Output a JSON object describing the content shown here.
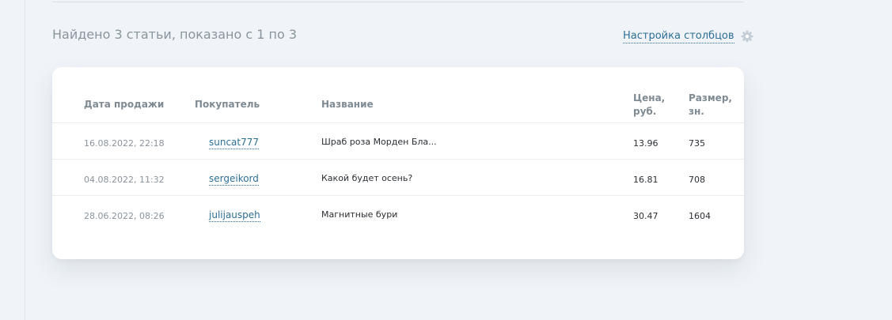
{
  "summary": "Найдено 3 статьи, показано с 1 по 3",
  "column_settings": {
    "label": "Настройка столбцов",
    "icon": "gear-icon"
  },
  "table": {
    "headers": {
      "date": "Дата продажи",
      "buyer": "Покупатель",
      "title": "Название",
      "price_line1": "Цена,",
      "price_line2": "руб.",
      "size_line1": "Размер,",
      "size_line2": "зн."
    },
    "rows": [
      {
        "date": "16.08.2022, 22:18",
        "buyer": "suncat777",
        "title": "Шраб роза Морден Бла...",
        "price": "13.96",
        "size": "735"
      },
      {
        "date": "04.08.2022, 11:32",
        "buyer": "sergeikord",
        "title": "Какой будет осень?",
        "price": "16.81",
        "size": "708"
      },
      {
        "date": "28.06.2022, 08:26",
        "buyer": "julijauspeh",
        "title": "Магнитные бури",
        "price": "30.47",
        "size": "1604"
      }
    ]
  },
  "colors": {
    "background": "#f0f4f8",
    "link": "#2d6f96",
    "muted_text": "#8a949d",
    "header_text": "#7f8a93",
    "gear": "#c5ced6"
  }
}
